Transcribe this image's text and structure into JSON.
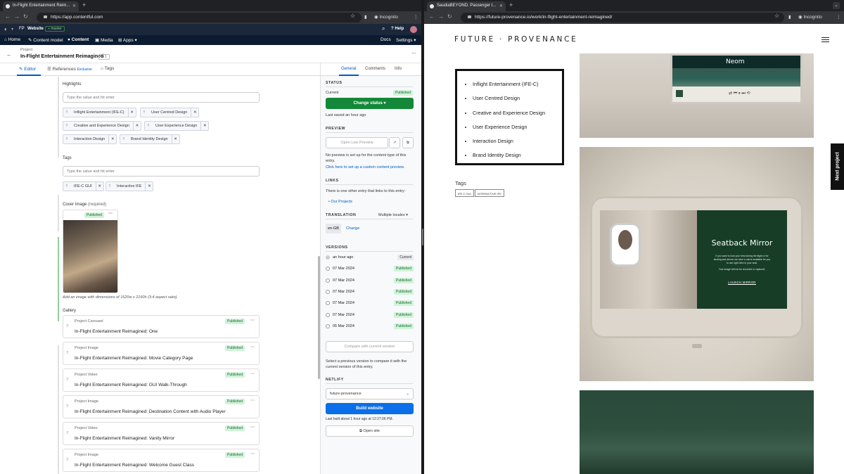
{
  "left_browser": {
    "tab_title": "In-Flight Entertainment Reim...",
    "url": "https://app.contentful.com",
    "incognito": "Incognito"
  },
  "cf_top": {
    "space_badge": "FP",
    "space": "Website",
    "env": "master",
    "help": "Help"
  },
  "cf_nav": {
    "home": "Home",
    "content_model": "Content model",
    "content": "Content",
    "media": "Media",
    "apps": "Apps",
    "docs": "Docs",
    "settings": "Settings"
  },
  "entry": {
    "type": "Project",
    "title": "In-Flight Entertainment Reimagined",
    "count_badge": "1",
    "tabs": {
      "editor": "Editor",
      "references": "References",
      "exclusive": "Exclusive",
      "tags": "Tags"
    }
  },
  "fields": {
    "highlights_label": "Highlights",
    "highlights_placeholder": "Type the value and hit enter",
    "highlights": [
      "Inflight Entertainment (IFE-C)",
      "User Centred Design",
      "Creative and Experience Design",
      "User Experience Design",
      "Interaction Design",
      "Brand Identity Design"
    ],
    "tags_label": "Tags",
    "tags_placeholder": "Type the value and hit enter",
    "tags": [
      "IFE-C GUI",
      "Interactive IFE"
    ],
    "cover_label": "Cover Image",
    "cover_required": "(required)",
    "cover_status": "Published",
    "cover_hint": "Add an image with dimensions of 1620w x 2160h (3:4 aspect ratio).",
    "gallery_label": "Gallery",
    "gallery": [
      {
        "type": "Project Carousel",
        "title": "In-Flight Entertainment Reimagined: One",
        "status": "Published"
      },
      {
        "type": "Project Image",
        "title": "In-Flight Entertainment Reimagined: Movie Category Page",
        "status": "Published"
      },
      {
        "type": "Project Video",
        "title": "In-Flight Entertainment Reimagined: GUI Walk-Through",
        "status": "Published"
      },
      {
        "type": "Project Image",
        "title": "In-Flight Entertainment Reimagined: Destination Content with Audio Player",
        "status": "Published"
      },
      {
        "type": "Project Video",
        "title": "In-Flight Entertainment Reimagined: Vanity Mirror",
        "status": "Published"
      },
      {
        "type": "Project Image",
        "title": "In-Flight Entertainment Reimagined: Welcome Guest Class",
        "status": "Published"
      }
    ]
  },
  "sidebar": {
    "tabs": {
      "general": "General",
      "comments": "Comments",
      "info": "Info"
    },
    "status_h": "STATUS",
    "current": "Current",
    "current_status": "Published",
    "change_status": "Change status",
    "last_saved": "Last saved an hour ago",
    "preview_h": "PREVIEW",
    "open_live_preview": "Open Live Preview",
    "preview_note": "No preview is set up for the content type of this entry.",
    "preview_link": "Click here to set up a custom content preview.",
    "links_h": "LINKS",
    "links_note": "There is one other entry that links to this entry:",
    "links_item": "Our Projects",
    "translation_h": "TRANSLATION",
    "multiple_locales": "Multiple locales",
    "locale": "en-GB",
    "change": "Change",
    "versions_h": "VERSIONS",
    "versions": [
      {
        "date": "an hour ago",
        "badge": "Current"
      },
      {
        "date": "07 Mar 2024",
        "badge": "Published"
      },
      {
        "date": "07 Mar 2024",
        "badge": "Published"
      },
      {
        "date": "07 Mar 2024",
        "badge": "Published"
      },
      {
        "date": "07 Mar 2024",
        "badge": "Published"
      },
      {
        "date": "07 Mar 2024",
        "badge": "Published"
      },
      {
        "date": "05 Mar 2024",
        "badge": "Published"
      }
    ],
    "compare": "Compare with current version",
    "compare_note": "Select a previous version to compare it with the current version of this entry.",
    "netlify_h": "NETLIFY",
    "netlify_site": "future-provenance",
    "build": "Build website",
    "last_built": "Last built about 1 hour ago at 12:27:06 PM.",
    "open_site": "Open site"
  },
  "right_browser": {
    "tab_title": "SaudiaBEYOND. Passenger I...",
    "url": "https://future-provenance.io/work/in-flight-entertainment-reimagined/",
    "incognito": "Incognito"
  },
  "site": {
    "logo": "FUTURE · PROVENANCE",
    "highlights": [
      "Inflight Entertainment (IFE-C)",
      "User Centred Design",
      "Creative and Experience Design",
      "User Experience Design",
      "Interaction Design",
      "Brand Identity Design"
    ],
    "tags_heading": "Tags",
    "tags": [
      "IFE-C GUI",
      "INTERACTIVE IFE"
    ],
    "neom": "Neom",
    "mirror_title": "Seatback Mirror",
    "mirror_text_1": "If you want to look your best during the flight or for landing and arrival, we have a mirror available for you to use right here in your seat.",
    "mirror_text_2": "Your image will not be recorded or captured.",
    "launch": "LAUNCH MIRROR",
    "next_project": "Next project"
  }
}
